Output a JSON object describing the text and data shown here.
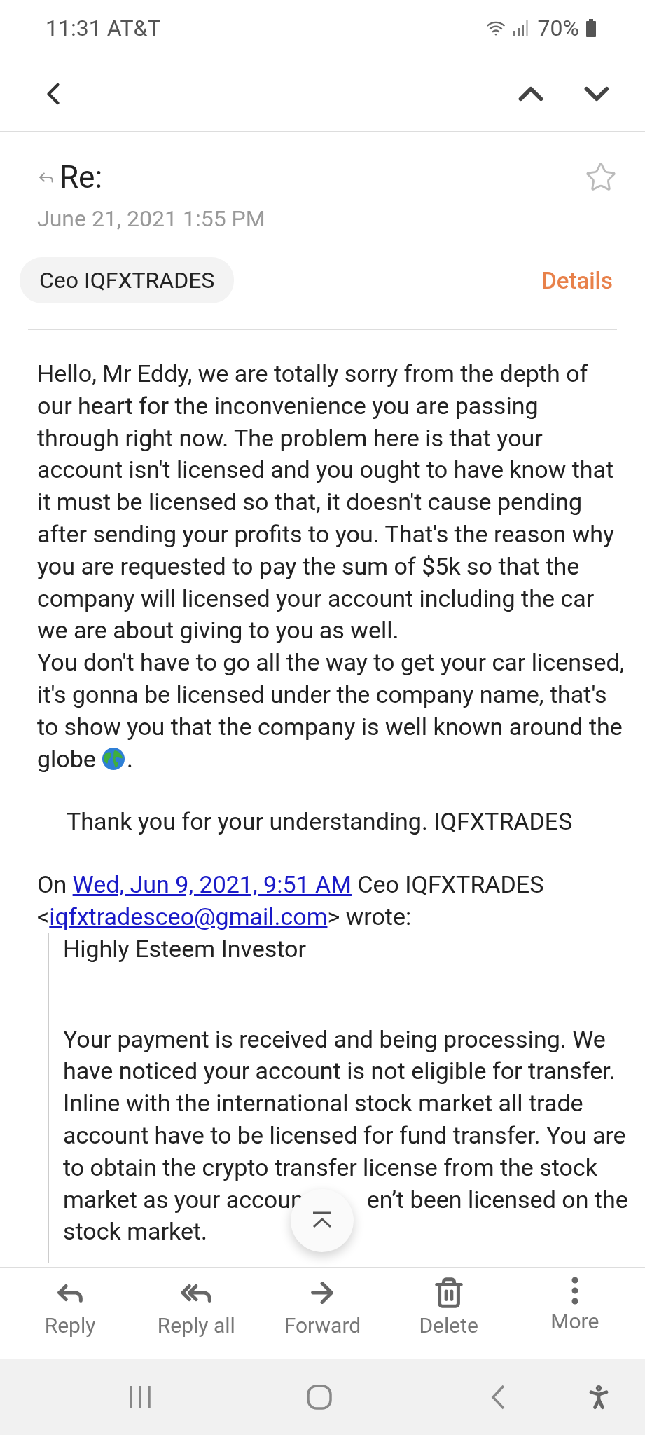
{
  "status_bar": {
    "time": "11:31",
    "carrier": "AT&T",
    "battery": "70%"
  },
  "message": {
    "subject": "Re:",
    "replied": true,
    "starred": false,
    "date": "June 21, 2021  1:55 PM",
    "sender": "Ceo IQFXTRADES",
    "details_link": "Details",
    "body_lines": [
      "Hello, Mr Eddy, we are totally sorry from the depth of",
      "our heart for the inconvenience you are passing",
      "through right now. The problem here is that your",
      "account isn't licensed and you ought to have know that",
      "it must be licensed so that, it doesn't cause pending",
      "after sending your profits to you. That's the reason why",
      "you are requested to pay the sum of $5k so that the",
      "company will licensed your account including the car",
      "we are about giving to you as well.",
      "You don't have to go all the way to get your car licensed,",
      "it's gonna be licensed under the company name,  that's",
      "to show you that the company is well known around the"
    ],
    "body_end": {
      "before": "globe",
      "after": "."
    },
    "signoff": "Thank you for your understanding. IQFXTRADES",
    "attribution": {
      "prefix": "On",
      "date_link": "Wed, Jun 9, 2021, 9:51 AM",
      "sender": "Ceo IQFXTRADES",
      "email_open": "<",
      "email_link": "iqfxtradesceo@gmail.com",
      "email_close": ">",
      "suffix": "wrote:"
    },
    "quote": {
      "greeting": "Highly Esteem Investor",
      "lines": [
        [
          "Your payment is received and being processing. We"
        ],
        [
          "have noticed your account is not eligible for transfer."
        ],
        [
          "Inline with the international stock market all trade"
        ],
        [
          "account have to be licensed for fund transfer. You are"
        ],
        [
          "to obtain the crypto transfer license from the stock"
        ],
        [
          "market as your accoun",
          "en’t been licensed on the"
        ],
        [
          "stock market."
        ]
      ]
    }
  },
  "actions": [
    {
      "kind": "reply",
      "label": "Reply"
    },
    {
      "kind": "reply_all",
      "label": "Reply all"
    },
    {
      "kind": "forward",
      "label": "Forward"
    },
    {
      "kind": "delete",
      "label": "Delete"
    },
    {
      "kind": "more",
      "label": "More"
    }
  ]
}
